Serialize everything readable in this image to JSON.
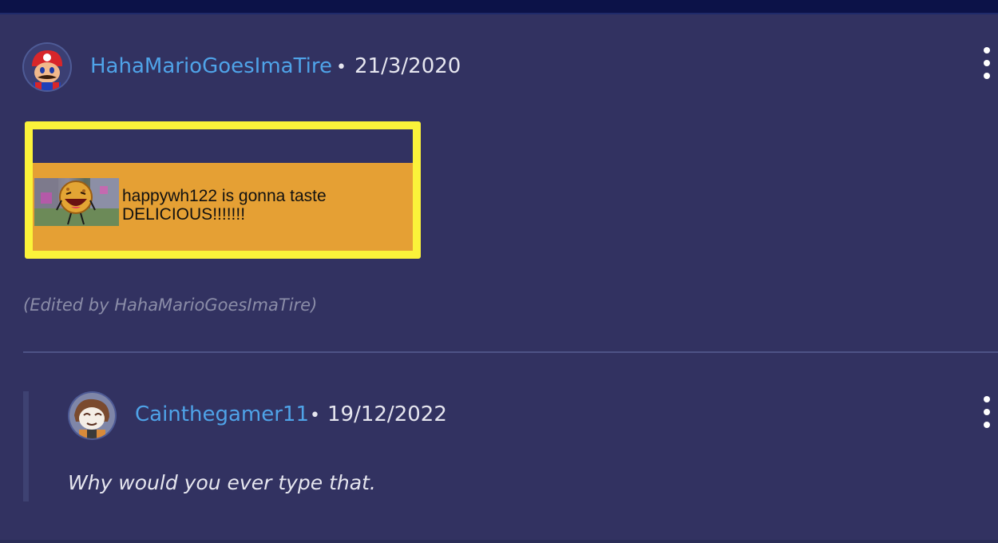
{
  "comment": {
    "username": "HahaMarioGoesImaTire",
    "separator": "•",
    "date": "21/3/2020",
    "embed_text": "happywh122 is gonna taste DELICIOUS!!!!!!!",
    "edited_note": "(Edited by HahaMarioGoesImaTire)"
  },
  "reply": {
    "username": "Cainthegamer11",
    "separator": "•",
    "date": "19/12/2022",
    "text": "Why would you ever type that."
  },
  "icons": {
    "more": "kebab-vertical-icon",
    "avatar_main": "mario-avatar",
    "avatar_reply": "user-avatar"
  },
  "colors": {
    "background": "#323261",
    "username": "#4fa3e8",
    "embed_border": "#fbf33a",
    "embed_fill": "#e5a034"
  }
}
